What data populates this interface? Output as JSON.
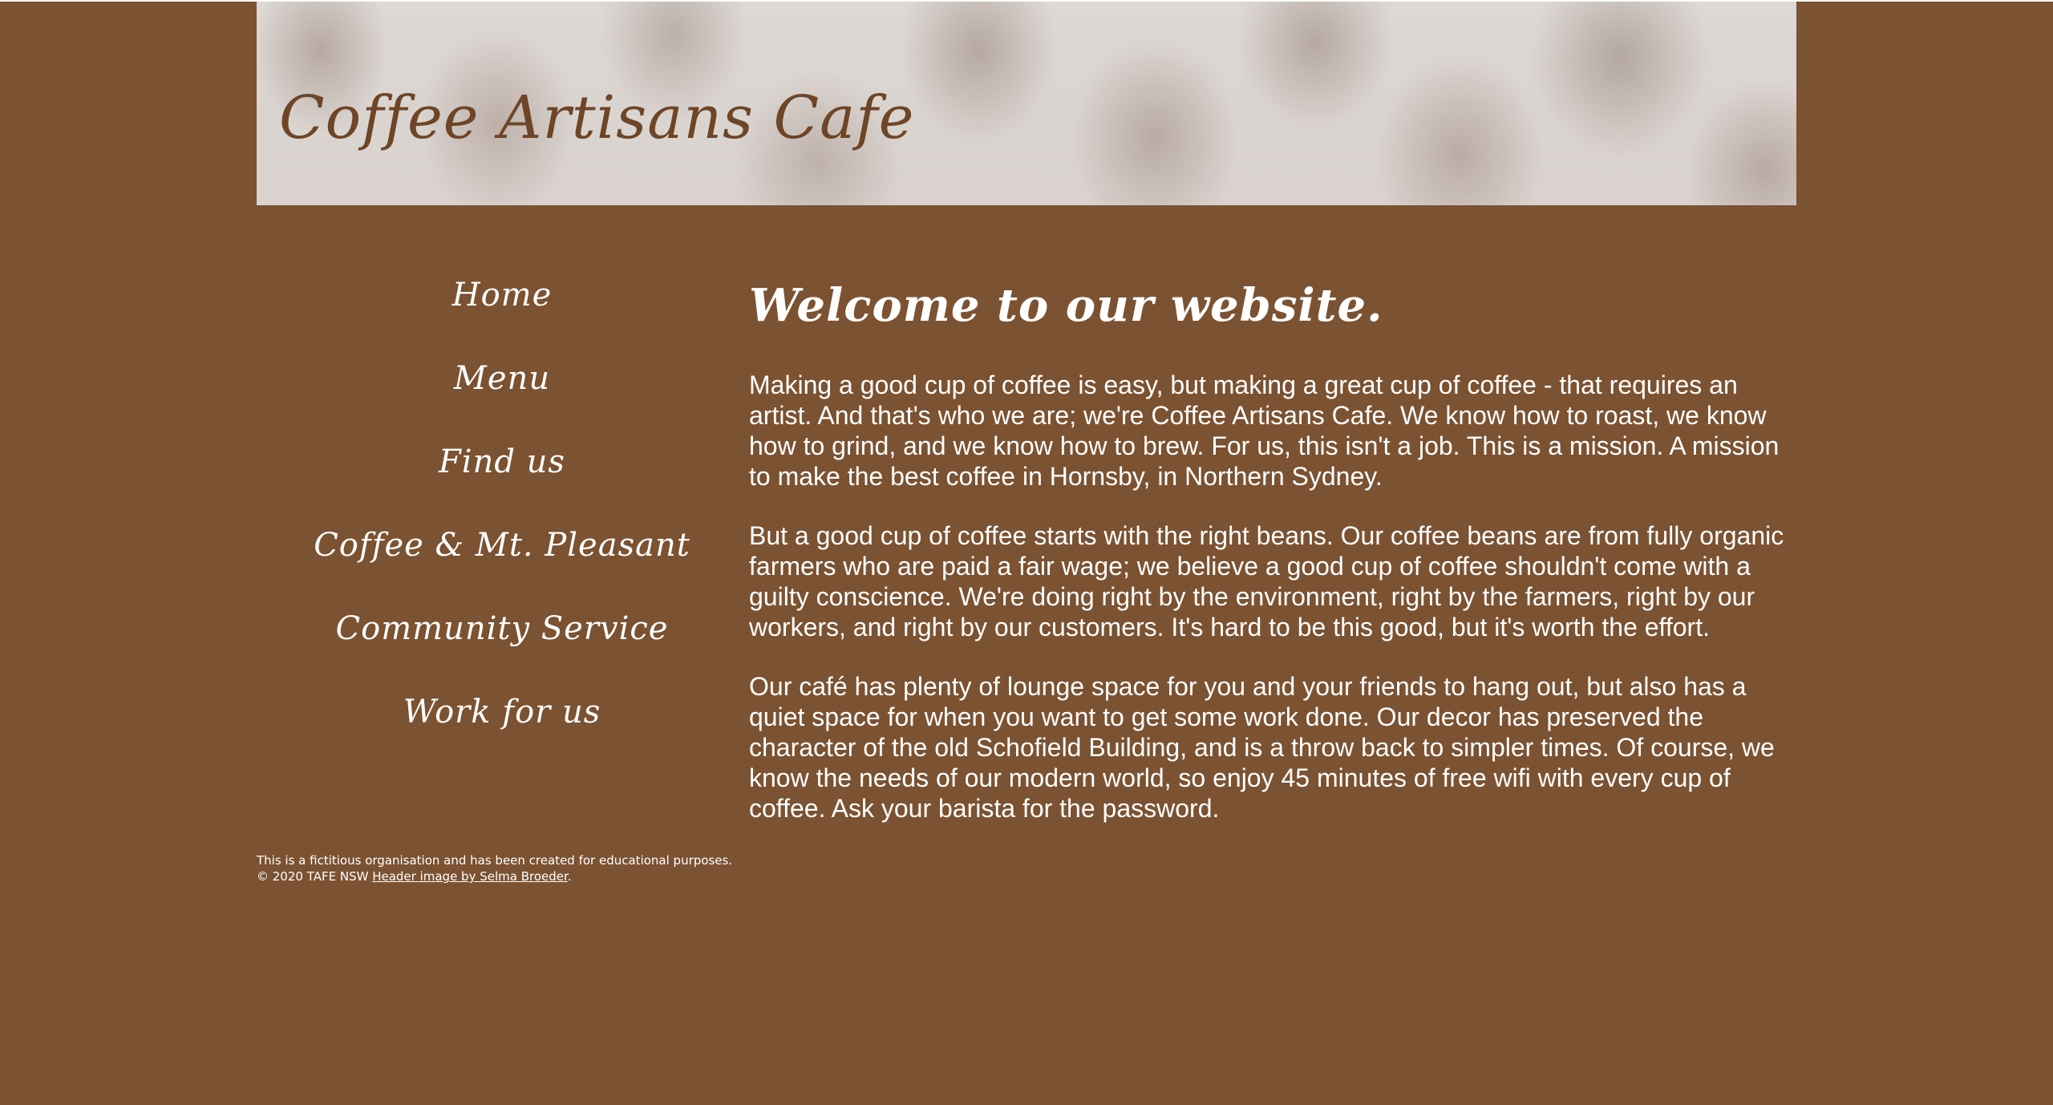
{
  "header": {
    "site_title": "Coffee Artisans Cafe",
    "background_image": "coffee-beans-image"
  },
  "nav": {
    "items": [
      {
        "label": "Home"
      },
      {
        "label": "Menu"
      },
      {
        "label": "Find us"
      },
      {
        "label": "Coffee & Mt. Pleasant"
      },
      {
        "label": "Community Service"
      },
      {
        "label": "Work for us"
      }
    ]
  },
  "main": {
    "heading": "Welcome to our website.",
    "paragraphs": [
      "Making a good cup of coffee is easy, but making a great cup of coffee - that requires an artist. And that's who we are; we're Coffee Artisans Cafe. We know how to roast, we know how to grind, and we know how to brew. For us, this isn't a job. This is a mission. A mission to make the best coffee in Hornsby, in Northern Sydney.",
      "But a good cup of coffee starts with the right beans. Our coffee beans are from fully organic farmers who are paid a fair wage; we believe a good cup of coffee shouldn't come with a guilty conscience. We're doing right by the environment, right by the farmers, right by our workers, and right by our customers. It's hard to be this good, but it's worth the effort.",
      "Our café has plenty of lounge space for you and your friends to hang out, but also has a quiet space for when you want to get some work done. Our decor has preserved the character of the old Schofield Building, and is a throw back to simpler times. Of course, we know the needs of our modern world, so enjoy 45 minutes of free wifi with every cup of coffee. Ask your barista for the password."
    ]
  },
  "footer": {
    "disclaimer": "This is a fictitious organisation and has been created for educational purposes.",
    "copyright": "© 2020 TAFE NSW ",
    "image_credit": "Header image by Selma Broeder",
    "period": "."
  },
  "colors": {
    "background": "#7b5232",
    "title_brown": "#6e4526",
    "text": "#ffffff"
  }
}
